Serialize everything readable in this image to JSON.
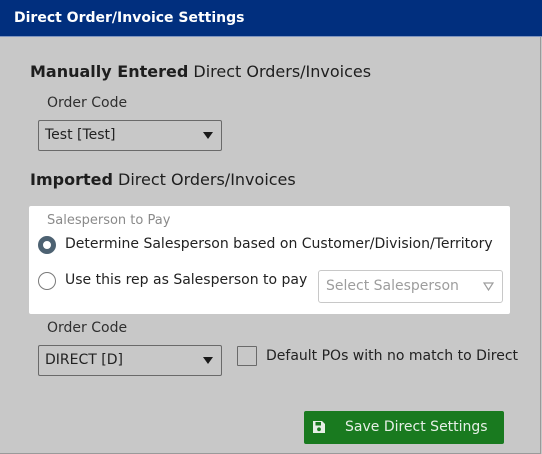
{
  "dialog": {
    "title": "Direct Order/Invoice Settings"
  },
  "manual": {
    "heading_bold": "Manually Entered",
    "heading_rest": " Direct Orders/Invoices",
    "order_code_label": "Order Code",
    "order_code_value": "Test [Test]"
  },
  "imported": {
    "heading_bold": "Imported",
    "heading_rest": " Direct Orders/Invoices",
    "salesperson_panel": {
      "label": "Salesperson to Pay",
      "option_determine": "Determine Salesperson based on Customer/Division/Territory",
      "option_use_rep": "Use this rep as Salesperson to pay",
      "selected_option": "determine",
      "salesperson_placeholder": "Select Salesperson"
    },
    "order_code_label": "Order Code",
    "order_code_value": "DIRECT [D]",
    "default_pos_label": "Default POs with no match to Direct",
    "default_pos_checked": false
  },
  "actions": {
    "save_label": "Save Direct Settings",
    "save_icon": "floppy-disk-icon"
  },
  "colors": {
    "titlebar": "#012f7e",
    "background": "#c8c8c8",
    "save_button": "#197a1f",
    "radio_checked": "#4d6272"
  }
}
